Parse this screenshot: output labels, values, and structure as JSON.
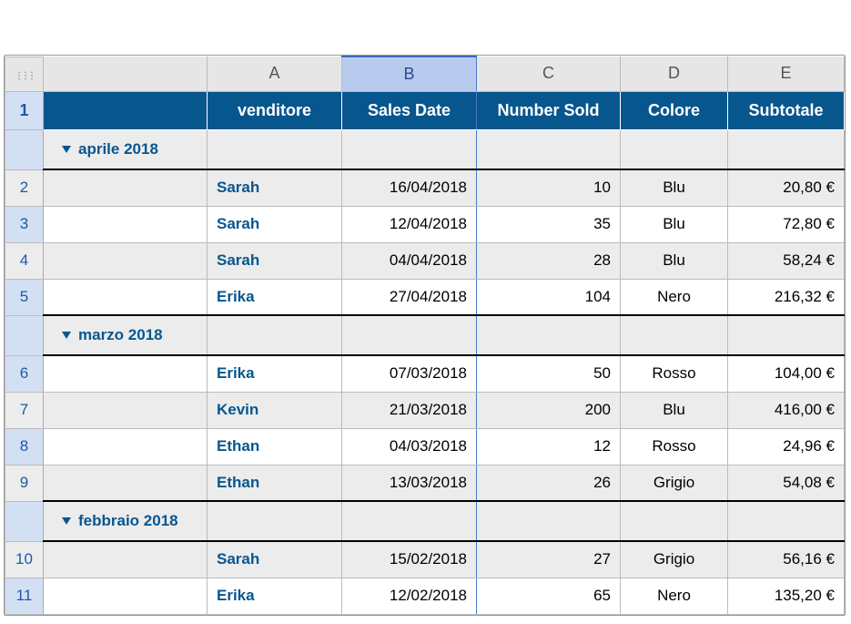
{
  "columns": {
    "letters": [
      "A",
      "B",
      "C",
      "D",
      "E"
    ],
    "selected_index": 1,
    "headers": {
      "group": "",
      "A": "venditore",
      "B": "Sales Date",
      "C": "Number Sold",
      "D": "Colore",
      "E": "Subtotale"
    }
  },
  "header_row_number": "1",
  "groups": [
    {
      "label": "aprile 2018",
      "rows": [
        {
          "n": "2",
          "vendor": "Sarah",
          "date": "16/04/2018",
          "sold": "10",
          "color": "Blu",
          "subtotal": "20,80 €",
          "shaded": true
        },
        {
          "n": "3",
          "vendor": "Sarah",
          "date": "12/04/2018",
          "sold": "35",
          "color": "Blu",
          "subtotal": "72,80 €",
          "shaded": false
        },
        {
          "n": "4",
          "vendor": "Sarah",
          "date": "04/04/2018",
          "sold": "28",
          "color": "Blu",
          "subtotal": "58,24 €",
          "shaded": true
        },
        {
          "n": "5",
          "vendor": "Erika",
          "date": "27/04/2018",
          "sold": "104",
          "color": "Nero",
          "subtotal": "216,32 €",
          "shaded": false
        }
      ]
    },
    {
      "label": "marzo 2018",
      "rows": [
        {
          "n": "6",
          "vendor": "Erika",
          "date": "07/03/2018",
          "sold": "50",
          "color": "Rosso",
          "subtotal": "104,00 €",
          "shaded": false
        },
        {
          "n": "7",
          "vendor": "Kevin",
          "date": "21/03/2018",
          "sold": "200",
          "color": "Blu",
          "subtotal": "416,00 €",
          "shaded": true
        },
        {
          "n": "8",
          "vendor": "Ethan",
          "date": "04/03/2018",
          "sold": "12",
          "color": "Rosso",
          "subtotal": "24,96 €",
          "shaded": false
        },
        {
          "n": "9",
          "vendor": "Ethan",
          "date": "13/03/2018",
          "sold": "26",
          "color": "Grigio",
          "subtotal": "54,08 €",
          "shaded": true
        }
      ]
    },
    {
      "label": "febbraio 2018",
      "rows": [
        {
          "n": "10",
          "vendor": "Sarah",
          "date": "15/02/2018",
          "sold": "27",
          "color": "Grigio",
          "subtotal": "56,16 €",
          "shaded": true
        },
        {
          "n": "11",
          "vendor": "Erika",
          "date": "12/02/2018",
          "sold": "65",
          "color": "Nero",
          "subtotal": "135,20 €",
          "shaded": false
        }
      ]
    }
  ]
}
